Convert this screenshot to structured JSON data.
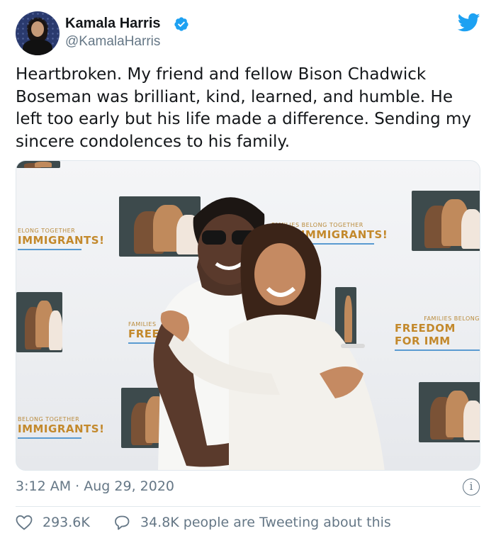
{
  "author": {
    "name": "Kamala Harris",
    "handle": "@KamalaHarris",
    "verified": true
  },
  "tweet": {
    "text": "Heartbroken. My friend and fellow Bison Chadwick Boseman was brilliant, kind, learned, and humble. He left too early but his life made a difference. Sending my sincere condolences to his family."
  },
  "photo": {
    "banners": {
      "left_top_small": "ELONG TOGETHER",
      "left_top_big": "IMMIGRANTS!",
      "center_top_small": "FAMILIES BELONG TOGETHER",
      "center_top_big": "FOR IMMIGRANTS!",
      "center_mid_small": "FAMILIES",
      "center_mid_big": "FREEDOM FO",
      "right_mid_small": "FAMILIES BELONG",
      "right_mid_big": "FREEDOM FOR IMM",
      "left_bottom_small": "BELONG TOGETHER",
      "left_bottom_big": "IMMIGRANTS!"
    }
  },
  "meta": {
    "time": "3:12 AM",
    "separator": "·",
    "date": "Aug 29, 2020"
  },
  "stats": {
    "likes": "293.6K",
    "tweeting": "34.8K people are Tweeting about this"
  },
  "colors": {
    "twitter_blue": "#1da1f2",
    "secondary_text": "#657786",
    "banner_gold": "#c3892c"
  },
  "icons": {
    "verified": "verified-badge-icon",
    "bird": "twitter-bird-icon",
    "info": "info-icon",
    "like": "heart-icon",
    "reply": "speech-bubble-icon"
  }
}
